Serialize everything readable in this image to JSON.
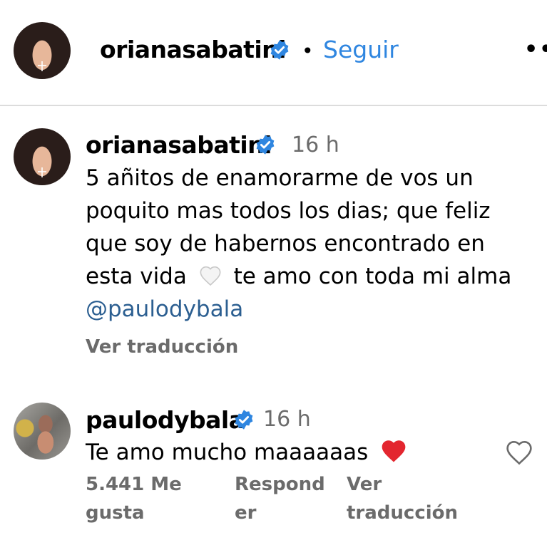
{
  "header": {
    "username": "orianasabatini",
    "separator": "•",
    "follow_label": "Seguir",
    "more_label": "••"
  },
  "caption": {
    "username": "orianasabatini",
    "time": "16 h",
    "lines": [
      "5 añitos de enamorarme de vos un",
      "poquito mas todos los dias; que feliz",
      "que soy de habernos encontrado en",
      "esta vida",
      "te amo con toda mi alma"
    ],
    "mention": "@paulodybala",
    "translate": "Ver traducción"
  },
  "comment": {
    "username": "paulodybala",
    "time": "16 h",
    "text": "Te amo mucho maaaaaas",
    "likes_line1": "5.441 Me",
    "likes_line2": "gusta",
    "reply_line1": "Respond",
    "reply_line2": "er",
    "translate_line1": "Ver",
    "translate_line2": "traducción"
  },
  "colors": {
    "link_blue": "#2f86e0",
    "mention_blue": "#2c5f91",
    "verified_blue": "#2f86e0",
    "heart_red": "#e3262f"
  }
}
